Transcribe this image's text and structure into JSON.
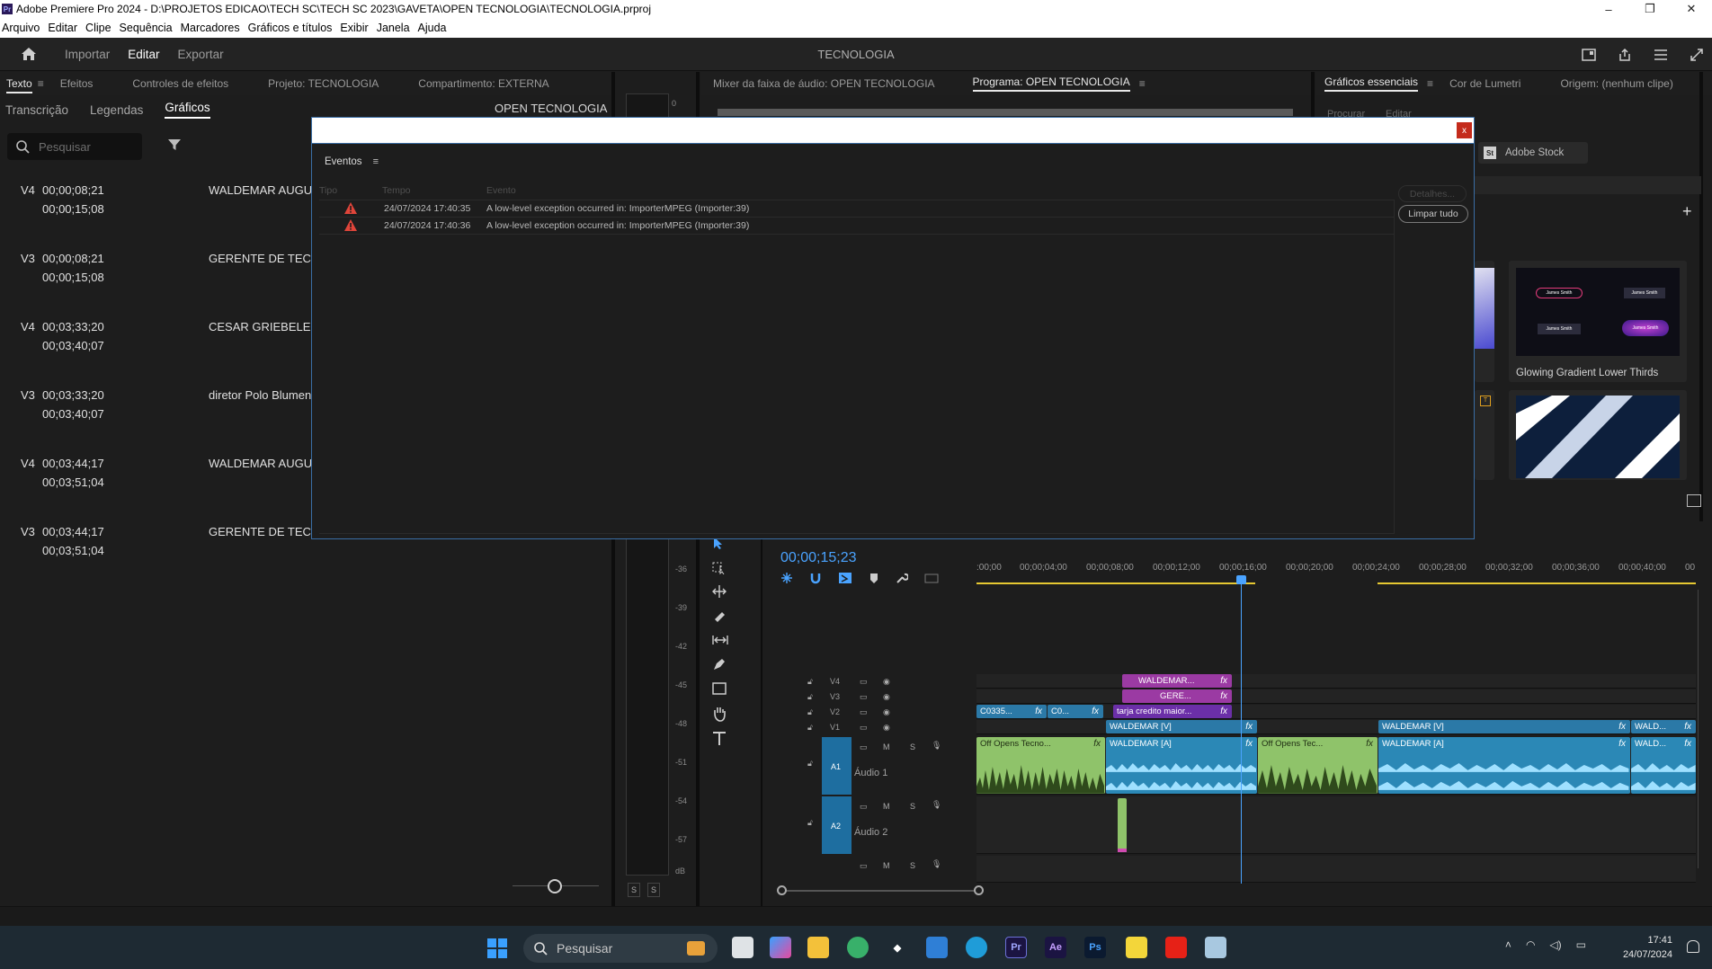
{
  "window": {
    "app_badge": "Pr",
    "title": "Adobe Premiere Pro 2024 - D:\\PROJETOS EDICAO\\TECH SC\\TECH SC 2023\\GAVETA\\OPEN TECNOLOGIA\\TECNOLOGIA.prproj",
    "controls": [
      "–",
      "❐",
      "✕"
    ]
  },
  "menu": [
    "Arquivo",
    "Editar",
    "Clipe",
    "Sequência",
    "Marcadores",
    "Gráficos e títulos",
    "Exibir",
    "Janela",
    "Ajuda"
  ],
  "header": {
    "modes": [
      "Importar",
      "Editar",
      "Exportar"
    ],
    "active_mode": "Editar",
    "project_title": "TECNOLOGIA"
  },
  "left_tabs": {
    "texto": "Texto",
    "efeitos": "Efeitos",
    "controles": "Controles de efeitos",
    "projeto": "Projeto: TECNOLOGIA",
    "compartimento": "Compartimento: EXTERNA"
  },
  "mid_tabs": {
    "mixer": "Mixer da faixa de áudio: OPEN TECNOLOGIA",
    "programa": "Programa: OPEN TECNOLOGIA"
  },
  "right_tabs": {
    "graficos": "Gráficos essenciais",
    "lumetri": "Cor de Lumetri",
    "origem": "Origem: (nenhum clipe)"
  },
  "text_panel": {
    "subtabs": [
      "Transcrição",
      "Legendas",
      "Gráficos"
    ],
    "active_subtab": "Gráficos",
    "search_placeholder": "Pesquisar",
    "sequence_name": "OPEN TECNOLOGIA",
    "captions": [
      {
        "track": "V4",
        "in": "00;00;08;21",
        "out": "00;00;15;08",
        "text": "WALDEMAR AUGUS"
      },
      {
        "track": "V3",
        "in": "00;00;08;21",
        "out": "00;00;15;08",
        "text": "GERENTE DE TECNO"
      },
      {
        "track": "V4",
        "in": "00;03;33;20",
        "out": "00;03;40;07",
        "text": "CESAR GRIEBELER"
      },
      {
        "track": "V3",
        "in": "00;03;33;20",
        "out": "00;03;40;07",
        "text": "diretor Polo Blumena"
      },
      {
        "track": "V4",
        "in": "00;03;44;17",
        "out": "00;03;51;04",
        "text": "WALDEMAR AUGUS"
      },
      {
        "track": "V3",
        "in": "00;03;44;17",
        "out": "00;03;51;04",
        "text": "GERENTE DE TECNO"
      }
    ]
  },
  "meter": {
    "labels": [
      "0",
      "-36",
      "-39",
      "-42",
      "-45",
      "-48",
      "-51",
      "-54",
      "-57",
      "dB"
    ],
    "solo": [
      "S",
      "S"
    ]
  },
  "essential_graphics": {
    "sub_left": "Procurar",
    "sub_right": "Editar",
    "stock_badge": "St",
    "stock_label": "Adobe Stock",
    "template_1": "Glowing Gradient Lower Thirds",
    "mini_names": [
      "James Smith",
      "James Smith",
      "James Smith",
      "James Smith"
    ]
  },
  "dialog": {
    "close": "x",
    "tab": "Eventos",
    "columns": [
      "Tipo",
      "Tempo",
      "Evento"
    ],
    "events": [
      {
        "time": "24/07/2024 17:40:35",
        "message": "A low-level exception occurred in: ImporterMPEG (Importer:39)"
      },
      {
        "time": "24/07/2024 17:40:36",
        "message": "A low-level exception occurred in: ImporterMPEG (Importer:39)"
      }
    ],
    "details_button": "Detalhes...",
    "clear_button": "Limpar tudo"
  },
  "timeline": {
    "timecode": "00;00;15;23",
    "ruler": [
      ":00;00",
      "00;00;04;00",
      "00;00;08;00",
      "00;00;12;00",
      "00;00;16;00",
      "00;00;20;00",
      "00;00;24;00",
      "00;00;28;00",
      "00;00;32;00",
      "00;00;36;00",
      "00;00;40;00",
      "00"
    ],
    "tracks": {
      "v4": "V4",
      "v3": "V3",
      "v2": "V2",
      "v1": "V1",
      "a1": "A1",
      "a1_name": "Áudio 1",
      "a2": "A2",
      "a2_name": "Áudio 2",
      "m": "M",
      "s": "S"
    },
    "clips": {
      "v4_title": "WALDEMAR...",
      "v3_title": "GERE...",
      "v2_a": "C0335...",
      "v2_b": "C0...",
      "v2_c": "tarja credito maior...",
      "v1_a": "WALDEMAR [V]",
      "v1_b": "WALDEMAR [V]",
      "v1_c": "WALD...",
      "a1_a": "Off Opens Tecno...",
      "a1_b": "WALDEMAR [A]",
      "a1_c": "Off Opens Tec...",
      "a1_d": "WALDEMAR [A]",
      "a1_e": "WALD...",
      "fx": "fx"
    }
  },
  "taskbar": {
    "search_placeholder": "Pesquisar",
    "apps": [
      "Pr",
      "Ae",
      "Ps"
    ],
    "time": "17:41",
    "date": "24/07/2024"
  }
}
